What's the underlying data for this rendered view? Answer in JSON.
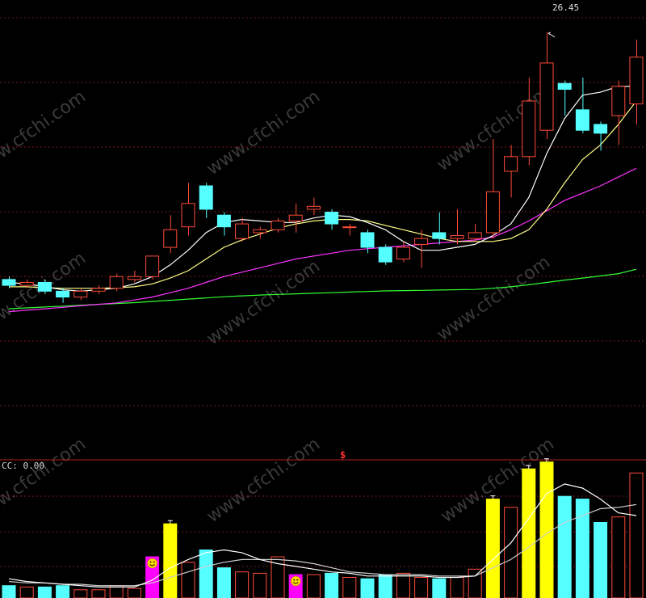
{
  "indicator_label": "CC: 0.00",
  "high_label": "26.45",
  "signal_mark": "$",
  "watermark": "www.cfchi.com",
  "colors": {
    "background": "#000000",
    "grid": "#7a1a1a",
    "up": "#ff4b3a",
    "down": "#55ffff",
    "ma5": "#ffffff",
    "ma10": "#ffff88",
    "ma20": "#ff33ff",
    "ma60": "#33ff33",
    "vol_up": "#ff4b3a",
    "vol_down": "#55ffff",
    "vol_yellow": "#ffff00",
    "vol_magenta": "#ff00ff",
    "smiley": "#ffd700"
  },
  "chart_data": [
    {
      "type": "candlestick",
      "ylim": [
        12.5,
        27
      ],
      "grid": true,
      "candles": [
        {
          "o": 18.0,
          "c": 17.8,
          "h": 18.1,
          "l": 17.7
        },
        {
          "o": 17.8,
          "c": 17.9,
          "h": 18.0,
          "l": 17.7
        },
        {
          "o": 17.9,
          "c": 17.6,
          "h": 18.0,
          "l": 17.5
        },
        {
          "o": 17.6,
          "c": 17.4,
          "h": 17.7,
          "l": 17.2
        },
        {
          "o": 17.4,
          "c": 17.6,
          "h": 17.7,
          "l": 17.3
        },
        {
          "o": 17.6,
          "c": 17.7,
          "h": 17.8,
          "l": 17.5
        },
        {
          "o": 17.7,
          "c": 18.1,
          "h": 18.2,
          "l": 17.6
        },
        {
          "o": 18.0,
          "c": 18.1,
          "h": 18.3,
          "l": 17.9
        },
        {
          "o": 18.1,
          "c": 18.8,
          "h": 18.8,
          "l": 18.0
        },
        {
          "o": 19.1,
          "c": 19.7,
          "h": 20.2,
          "l": 18.9
        },
        {
          "o": 19.8,
          "c": 20.6,
          "h": 21.3,
          "l": 19.5
        },
        {
          "o": 21.2,
          "c": 20.4,
          "h": 21.3,
          "l": 20.1
        },
        {
          "o": 20.2,
          "c": 19.8,
          "h": 20.3,
          "l": 19.5
        },
        {
          "o": 19.4,
          "c": 19.9,
          "h": 20.1,
          "l": 19.3
        },
        {
          "o": 19.6,
          "c": 19.7,
          "h": 19.8,
          "l": 19.4
        },
        {
          "o": 19.7,
          "c": 20.0,
          "h": 20.1,
          "l": 19.6
        },
        {
          "o": 20.0,
          "c": 20.2,
          "h": 20.6,
          "l": 19.6
        },
        {
          "o": 20.4,
          "c": 20.5,
          "h": 20.8,
          "l": 20.2
        },
        {
          "o": 20.3,
          "c": 19.9,
          "h": 20.4,
          "l": 19.7
        },
        {
          "o": 19.8,
          "c": 19.8,
          "h": 19.9,
          "l": 19.5
        },
        {
          "o": 19.6,
          "c": 19.1,
          "h": 19.7,
          "l": 18.9
        },
        {
          "o": 19.1,
          "c": 18.6,
          "h": 19.2,
          "l": 18.5
        },
        {
          "o": 18.7,
          "c": 19.1,
          "h": 19.3,
          "l": 18.6
        },
        {
          "o": 19.2,
          "c": 19.4,
          "h": 19.7,
          "l": 18.4
        },
        {
          "o": 19.6,
          "c": 19.4,
          "h": 20.3,
          "l": 19.2
        },
        {
          "o": 19.4,
          "c": 19.5,
          "h": 20.4,
          "l": 19.2
        },
        {
          "o": 19.4,
          "c": 19.6,
          "h": 19.9,
          "l": 19.3
        },
        {
          "o": 19.6,
          "c": 21.0,
          "h": 22.8,
          "l": 19.4
        },
        {
          "o": 21.7,
          "c": 22.2,
          "h": 22.6,
          "l": 20.8
        },
        {
          "o": 22.2,
          "c": 24.1,
          "h": 24.9,
          "l": 21.9
        },
        {
          "o": 23.1,
          "c": 25.4,
          "h": 26.45,
          "l": 22.8
        },
        {
          "o": 24.7,
          "c": 24.5,
          "h": 24.8,
          "l": 23.6
        },
        {
          "o": 23.8,
          "c": 23.1,
          "h": 24.9,
          "l": 23.0
        },
        {
          "o": 23.3,
          "c": 23.0,
          "h": 23.4,
          "l": 22.4
        },
        {
          "o": 23.6,
          "c": 24.6,
          "h": 24.8,
          "l": 22.6
        },
        {
          "o": 24.0,
          "c": 25.6,
          "h": 26.2,
          "l": 23.3
        }
      ],
      "ma5": [
        17.9,
        17.85,
        17.75,
        17.65,
        17.6,
        17.65,
        17.7,
        17.85,
        18.1,
        18.5,
        19.0,
        19.6,
        19.95,
        20.05,
        20.0,
        19.95,
        19.95,
        20.1,
        20.2,
        20.15,
        19.95,
        19.7,
        19.3,
        19.0,
        19.0,
        19.1,
        19.2,
        19.5,
        19.9,
        20.8,
        22.3,
        23.5,
        24.3,
        24.4,
        24.6,
        24.6
      ],
      "ma10": [
        17.75,
        17.75,
        17.72,
        17.7,
        17.7,
        17.7,
        17.72,
        17.75,
        17.85,
        18.05,
        18.3,
        18.7,
        19.1,
        19.35,
        19.55,
        19.75,
        19.9,
        20.0,
        20.05,
        20.05,
        20.0,
        19.85,
        19.7,
        19.55,
        19.4,
        19.3,
        19.3,
        19.3,
        19.4,
        19.7,
        20.4,
        21.3,
        22.1,
        22.6,
        23.3,
        24.1
      ],
      "ma20": [
        16.9,
        16.95,
        17.0,
        17.05,
        17.1,
        17.15,
        17.2,
        17.3,
        17.4,
        17.55,
        17.7,
        17.9,
        18.1,
        18.25,
        18.4,
        18.55,
        18.7,
        18.8,
        18.9,
        19.0,
        19.05,
        19.1,
        19.15,
        19.2,
        19.25,
        19.3,
        19.35,
        19.45,
        19.7,
        20.0,
        20.35,
        20.7,
        20.95,
        21.2,
        21.5,
        21.8
      ],
      "ma60": [
        17.0,
        17.03,
        17.06,
        17.09,
        17.12,
        17.15,
        17.18,
        17.21,
        17.25,
        17.29,
        17.33,
        17.37,
        17.41,
        17.44,
        17.47,
        17.49,
        17.51,
        17.53,
        17.55,
        17.57,
        17.59,
        17.61,
        17.62,
        17.63,
        17.64,
        17.65,
        17.66,
        17.7,
        17.75,
        17.82,
        17.9,
        17.98,
        18.05,
        18.12,
        18.2,
        18.35
      ],
      "high_marker": {
        "index": 30,
        "value": 26.45
      }
    },
    {
      "type": "bar",
      "ylim": [
        0,
        100
      ],
      "volume": [
        9,
        8,
        8,
        9,
        6,
        6,
        9,
        7,
        30,
        54,
        26,
        35,
        22,
        19,
        18,
        30,
        17,
        17,
        18,
        15,
        14,
        17,
        18,
        15,
        14,
        15,
        21,
        72,
        66,
        94,
        99,
        74,
        72,
        55,
        59,
        91
      ],
      "vol_ma5": [
        14,
        12,
        11,
        10,
        9,
        8,
        8,
        8,
        13,
        22,
        28,
        33,
        35,
        33,
        28,
        25,
        23,
        21,
        19,
        18,
        16,
        16,
        16,
        16,
        15,
        15,
        16,
        28,
        40,
        58,
        76,
        83,
        80,
        72,
        62,
        60
      ],
      "vol_ma10": [
        12,
        11,
        11,
        10,
        10,
        9,
        9,
        9,
        11,
        15,
        19,
        23,
        26,
        28,
        28,
        28,
        27,
        25,
        22,
        19,
        18,
        17,
        17,
        17,
        16,
        16,
        16,
        22,
        28,
        37,
        47,
        55,
        60,
        65,
        66,
        68
      ],
      "highlight": {
        "8": "magenta",
        "9": "yellow",
        "16": "magenta",
        "27": "yellow",
        "29": "yellow",
        "30": "yellow"
      },
      "smiley_at": [
        8,
        16
      ],
      "signal_index": 19,
      "indicator": "CC",
      "indicator_value": 0.0
    }
  ]
}
